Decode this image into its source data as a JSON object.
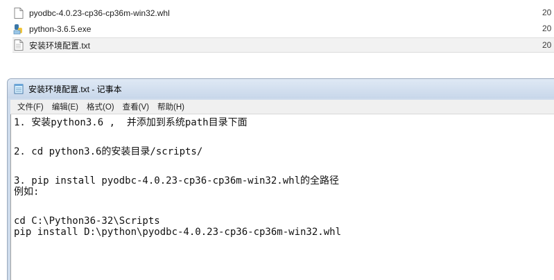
{
  "files": [
    {
      "icon": "whl-file-icon",
      "name": "pyodbc-4.0.23-cp36-cp36m-win32.whl",
      "date": "20"
    },
    {
      "icon": "python-installer-icon",
      "name": "python-3.6.5.exe",
      "date": "20"
    },
    {
      "icon": "txt-file-icon",
      "name": "安装环境配置.txt",
      "date": "20",
      "selected": true
    }
  ],
  "notepad": {
    "title": "安装环境配置.txt - 记事本",
    "menu": [
      "文件(F)",
      "编辑(E)",
      "格式(O)",
      "查看(V)",
      "帮助(H)"
    ],
    "lines": [
      "1. 安装python3.6 ,  并添加到系统path目录下面",
      "2. cd python3.6的安装目录/scripts/",
      "3. pip install pyodbc-4.0.23-cp36-cp36m-win32.whl的全路径",
      "例如:",
      "cd C:\\Python36-32\\Scripts",
      "pip install D:\\python\\pyodbc-4.0.23-cp36-cp36m-win32.whl"
    ]
  }
}
